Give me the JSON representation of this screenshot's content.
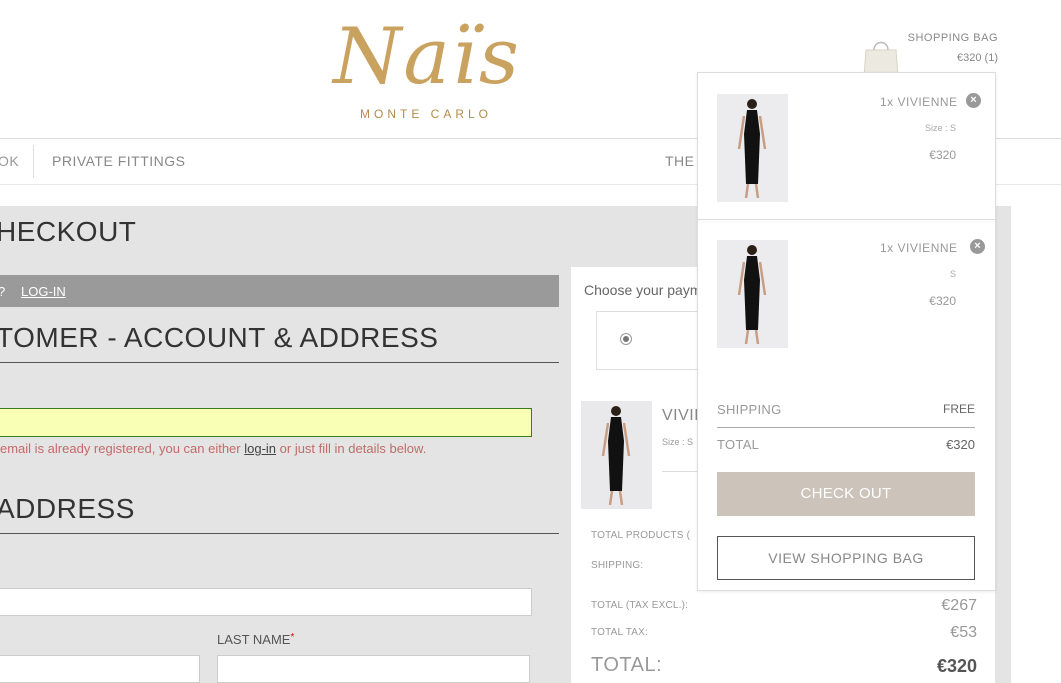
{
  "header": {
    "logo_text": "Naïs",
    "logo_sub": "MONTE CARLO",
    "bag_label": "SHOPPING BAG",
    "bag_total": "€320 (1)"
  },
  "nav": {
    "item_ok": "OK",
    "item_fittings": "PRIVATE FITTINGS",
    "item_the": "THE"
  },
  "checkout": {
    "title": "HECKOUT",
    "login_prompt": "?",
    "login_link": "LOG-IN",
    "account_title": "TOMER - ACCOUNT & ADDRESS",
    "email_msg_before": "email is already registered, you can either ",
    "email_msg_link": "log-in",
    "email_msg_after": " or just fill in details below.",
    "address_title": "ADDRESS",
    "lastname_label": "LAST NAME",
    "required_mark": "*"
  },
  "summary": {
    "pay_label": "Choose your paym",
    "product_name": "VIVIE",
    "product_size": "Size : S",
    "total_products_label": "TOTAL PRODUCTS (",
    "shipping_label": "SHIPPING:",
    "tax_excl_label": "TOTAL (TAX EXCL.):",
    "tax_excl_value": "€267",
    "tax_label": "TOTAL TAX:",
    "tax_value": "€53",
    "total_label": "TOTAL:",
    "total_value": "€320"
  },
  "bag": {
    "items": [
      {
        "qty_name": "1x  VIVIENNE",
        "size": "Size : S",
        "price": "€320"
      },
      {
        "qty_name": "1x  VIVIENNE",
        "size": "S",
        "price": "€320"
      }
    ],
    "shipping_label": "SHIPPING",
    "shipping_value": "FREE",
    "total_label": "TOTAL",
    "total_value": "€320",
    "checkout_label": "CHECK OUT",
    "view_bag_label": "VIEW SHOPPING BAG"
  }
}
